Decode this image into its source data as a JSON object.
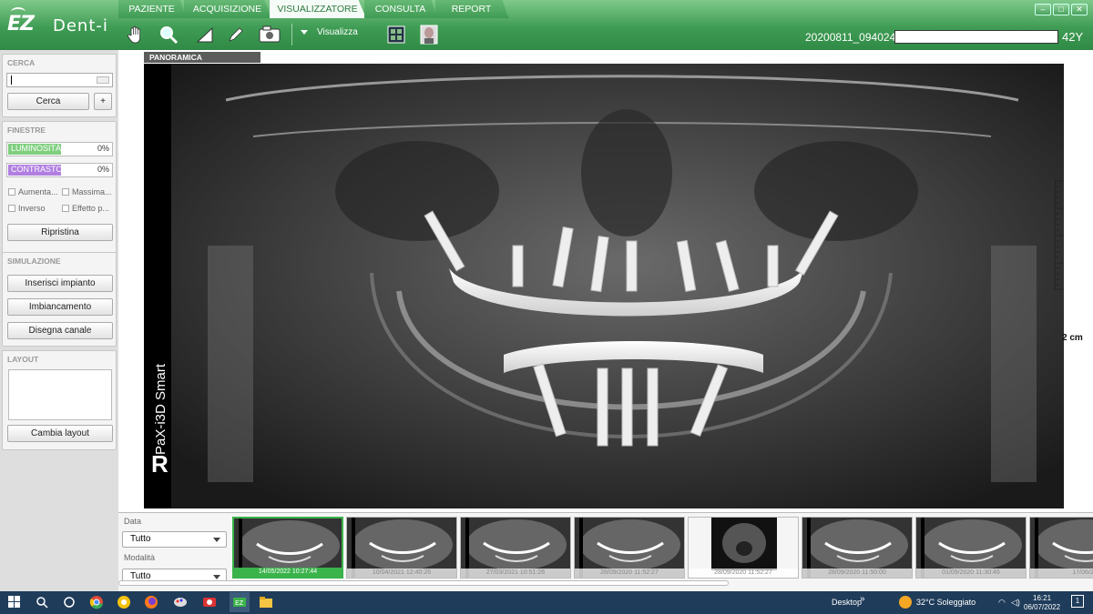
{
  "app": {
    "logo_main": "EZ",
    "logo_sub": "Dent-i",
    "tabs": [
      "PAZIENTE",
      "ACQUISIZIONE",
      "VISUALIZZATORE",
      "CONSULTA",
      "REPORT"
    ],
    "active_tab": "VISUALIZZATORE",
    "view_dropdown": "Visualizza",
    "patient_id": "20200811_094024",
    "patient_age": "42Y",
    "accent_color": "#3f9c54"
  },
  "sidebar": {
    "search": {
      "title": "CERCA",
      "input_value": "",
      "search_button": "Cerca",
      "add_button": "+"
    },
    "windows": {
      "title": "FINESTRE",
      "brightness": {
        "label": "LUMINOSITÀ",
        "value": "0%",
        "color": "#7fcf7f"
      },
      "contrast": {
        "label": "CONTRASTO",
        "value": "0%",
        "color": "#b07fe0"
      },
      "checkboxes": [
        "Aumenta...",
        "Massima...",
        "Inverso",
        "Effetto p..."
      ],
      "reset_button": "Ripristina"
    },
    "simulation": {
      "title": "SIMULAZIONE",
      "buttons": [
        "Inserisci impianto",
        "Imbiancamento",
        "Disegna canale"
      ]
    },
    "layout": {
      "title": "LAYOUT",
      "change_button": "Cambia layout"
    }
  },
  "viewer": {
    "tab_label": "PANORAMICA",
    "device_label": "PaX-i3D Smart",
    "side_marker": "R",
    "scale_label": "2 cm"
  },
  "filmstrip": {
    "date_label": "Data",
    "date_value": "Tutto",
    "modality_label": "Modalità",
    "modality_value": "Tutto",
    "thumbnails": [
      {
        "caption": "14/05/2022 10:27:44",
        "selected": true,
        "kind": "pano"
      },
      {
        "caption": "10/04/2021 12:40:26",
        "selected": false,
        "kind": "pano"
      },
      {
        "caption": "27/03/2021 10:51:26",
        "selected": false,
        "kind": "pano"
      },
      {
        "caption": "28/09/2020 11:52:27",
        "selected": false,
        "kind": "pano"
      },
      {
        "caption": "28/09/2020 11:52:27",
        "selected": false,
        "kind": "ct"
      },
      {
        "caption": "28/09/2020 11:50:00",
        "selected": false,
        "kind": "pano"
      },
      {
        "caption": "01/09/2020 11:30:46",
        "selected": false,
        "kind": "pano"
      },
      {
        "caption": "17/06/20",
        "selected": false,
        "kind": "pano"
      }
    ]
  },
  "taskbar": {
    "desktop_label": "Desktop",
    "weather": "32°C  Soleggiato",
    "time": "16:21",
    "date": "06/07/2022",
    "notification_count": "1"
  }
}
